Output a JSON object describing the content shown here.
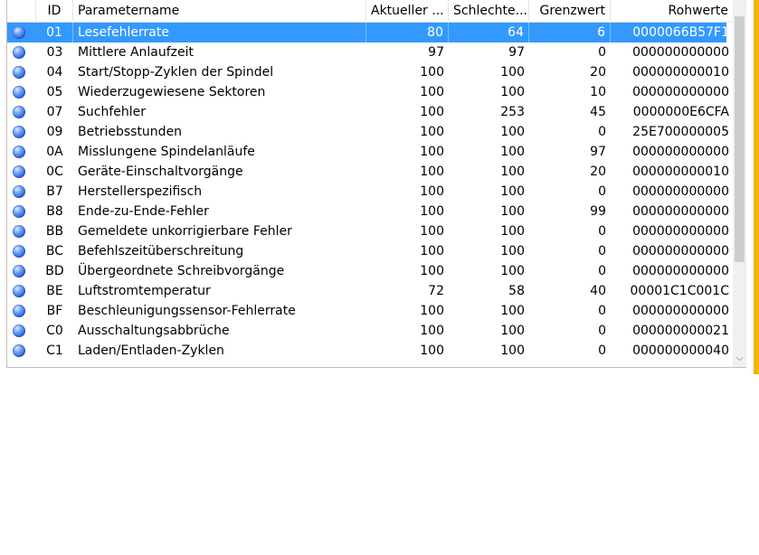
{
  "columns": {
    "id": "ID",
    "name": "Parametername",
    "current": "Aktueller ...",
    "worst": "Schlechte...",
    "threshold": "Grenzwert",
    "raw": "Rohwerte"
  },
  "rows": [
    {
      "id": "01",
      "name": "Lesefehlerrate",
      "current": "80",
      "worst": "64",
      "threshold": "6",
      "raw": "0000066B57F1",
      "selected": true
    },
    {
      "id": "03",
      "name": "Mittlere Anlaufzeit",
      "current": "97",
      "worst": "97",
      "threshold": "0",
      "raw": "000000000000"
    },
    {
      "id": "04",
      "name": "Start/Stopp-Zyklen der Spindel",
      "current": "100",
      "worst": "100",
      "threshold": "20",
      "raw": "000000000010"
    },
    {
      "id": "05",
      "name": "Wiederzugewiesene Sektoren",
      "current": "100",
      "worst": "100",
      "threshold": "10",
      "raw": "000000000000"
    },
    {
      "id": "07",
      "name": "Suchfehler",
      "current": "100",
      "worst": "253",
      "threshold": "45",
      "raw": "0000000E6CFA"
    },
    {
      "id": "09",
      "name": "Betriebsstunden",
      "current": "100",
      "worst": "100",
      "threshold": "0",
      "raw": "25E700000005"
    },
    {
      "id": "0A",
      "name": "Misslungene Spindelanläufe",
      "current": "100",
      "worst": "100",
      "threshold": "97",
      "raw": "000000000000"
    },
    {
      "id": "0C",
      "name": "Geräte-Einschaltvorgänge",
      "current": "100",
      "worst": "100",
      "threshold": "20",
      "raw": "000000000010"
    },
    {
      "id": "B7",
      "name": "Herstellerspezifisch",
      "current": "100",
      "worst": "100",
      "threshold": "0",
      "raw": "000000000000"
    },
    {
      "id": "B8",
      "name": "Ende-zu-Ende-Fehler",
      "current": "100",
      "worst": "100",
      "threshold": "99",
      "raw": "000000000000"
    },
    {
      "id": "BB",
      "name": "Gemeldete unkorrigierbare Fehler",
      "current": "100",
      "worst": "100",
      "threshold": "0",
      "raw": "000000000000"
    },
    {
      "id": "BC",
      "name": "Befehlszeitüberschreitung",
      "current": "100",
      "worst": "100",
      "threshold": "0",
      "raw": "000000000000"
    },
    {
      "id": "BD",
      "name": "Übergeordnete Schreibvorgänge",
      "current": "100",
      "worst": "100",
      "threshold": "0",
      "raw": "000000000000"
    },
    {
      "id": "BE",
      "name": "Luftstromtemperatur",
      "current": "72",
      "worst": "58",
      "threshold": "40",
      "raw": "00001C1C001C"
    },
    {
      "id": "BF",
      "name": "Beschleunigungssensor-Fehlerrate",
      "current": "100",
      "worst": "100",
      "threshold": "0",
      "raw": "000000000000"
    },
    {
      "id": "C0",
      "name": "Ausschaltungsabbrüche",
      "current": "100",
      "worst": "100",
      "threshold": "0",
      "raw": "000000000021"
    },
    {
      "id": "C1",
      "name": "Laden/Entladen-Zyklen",
      "current": "100",
      "worst": "100",
      "threshold": "0",
      "raw": "000000000040"
    }
  ],
  "status_icon": "blue-orb-icon",
  "colors": {
    "selection": "#3399ff",
    "accent_edge": "#f3b400"
  }
}
